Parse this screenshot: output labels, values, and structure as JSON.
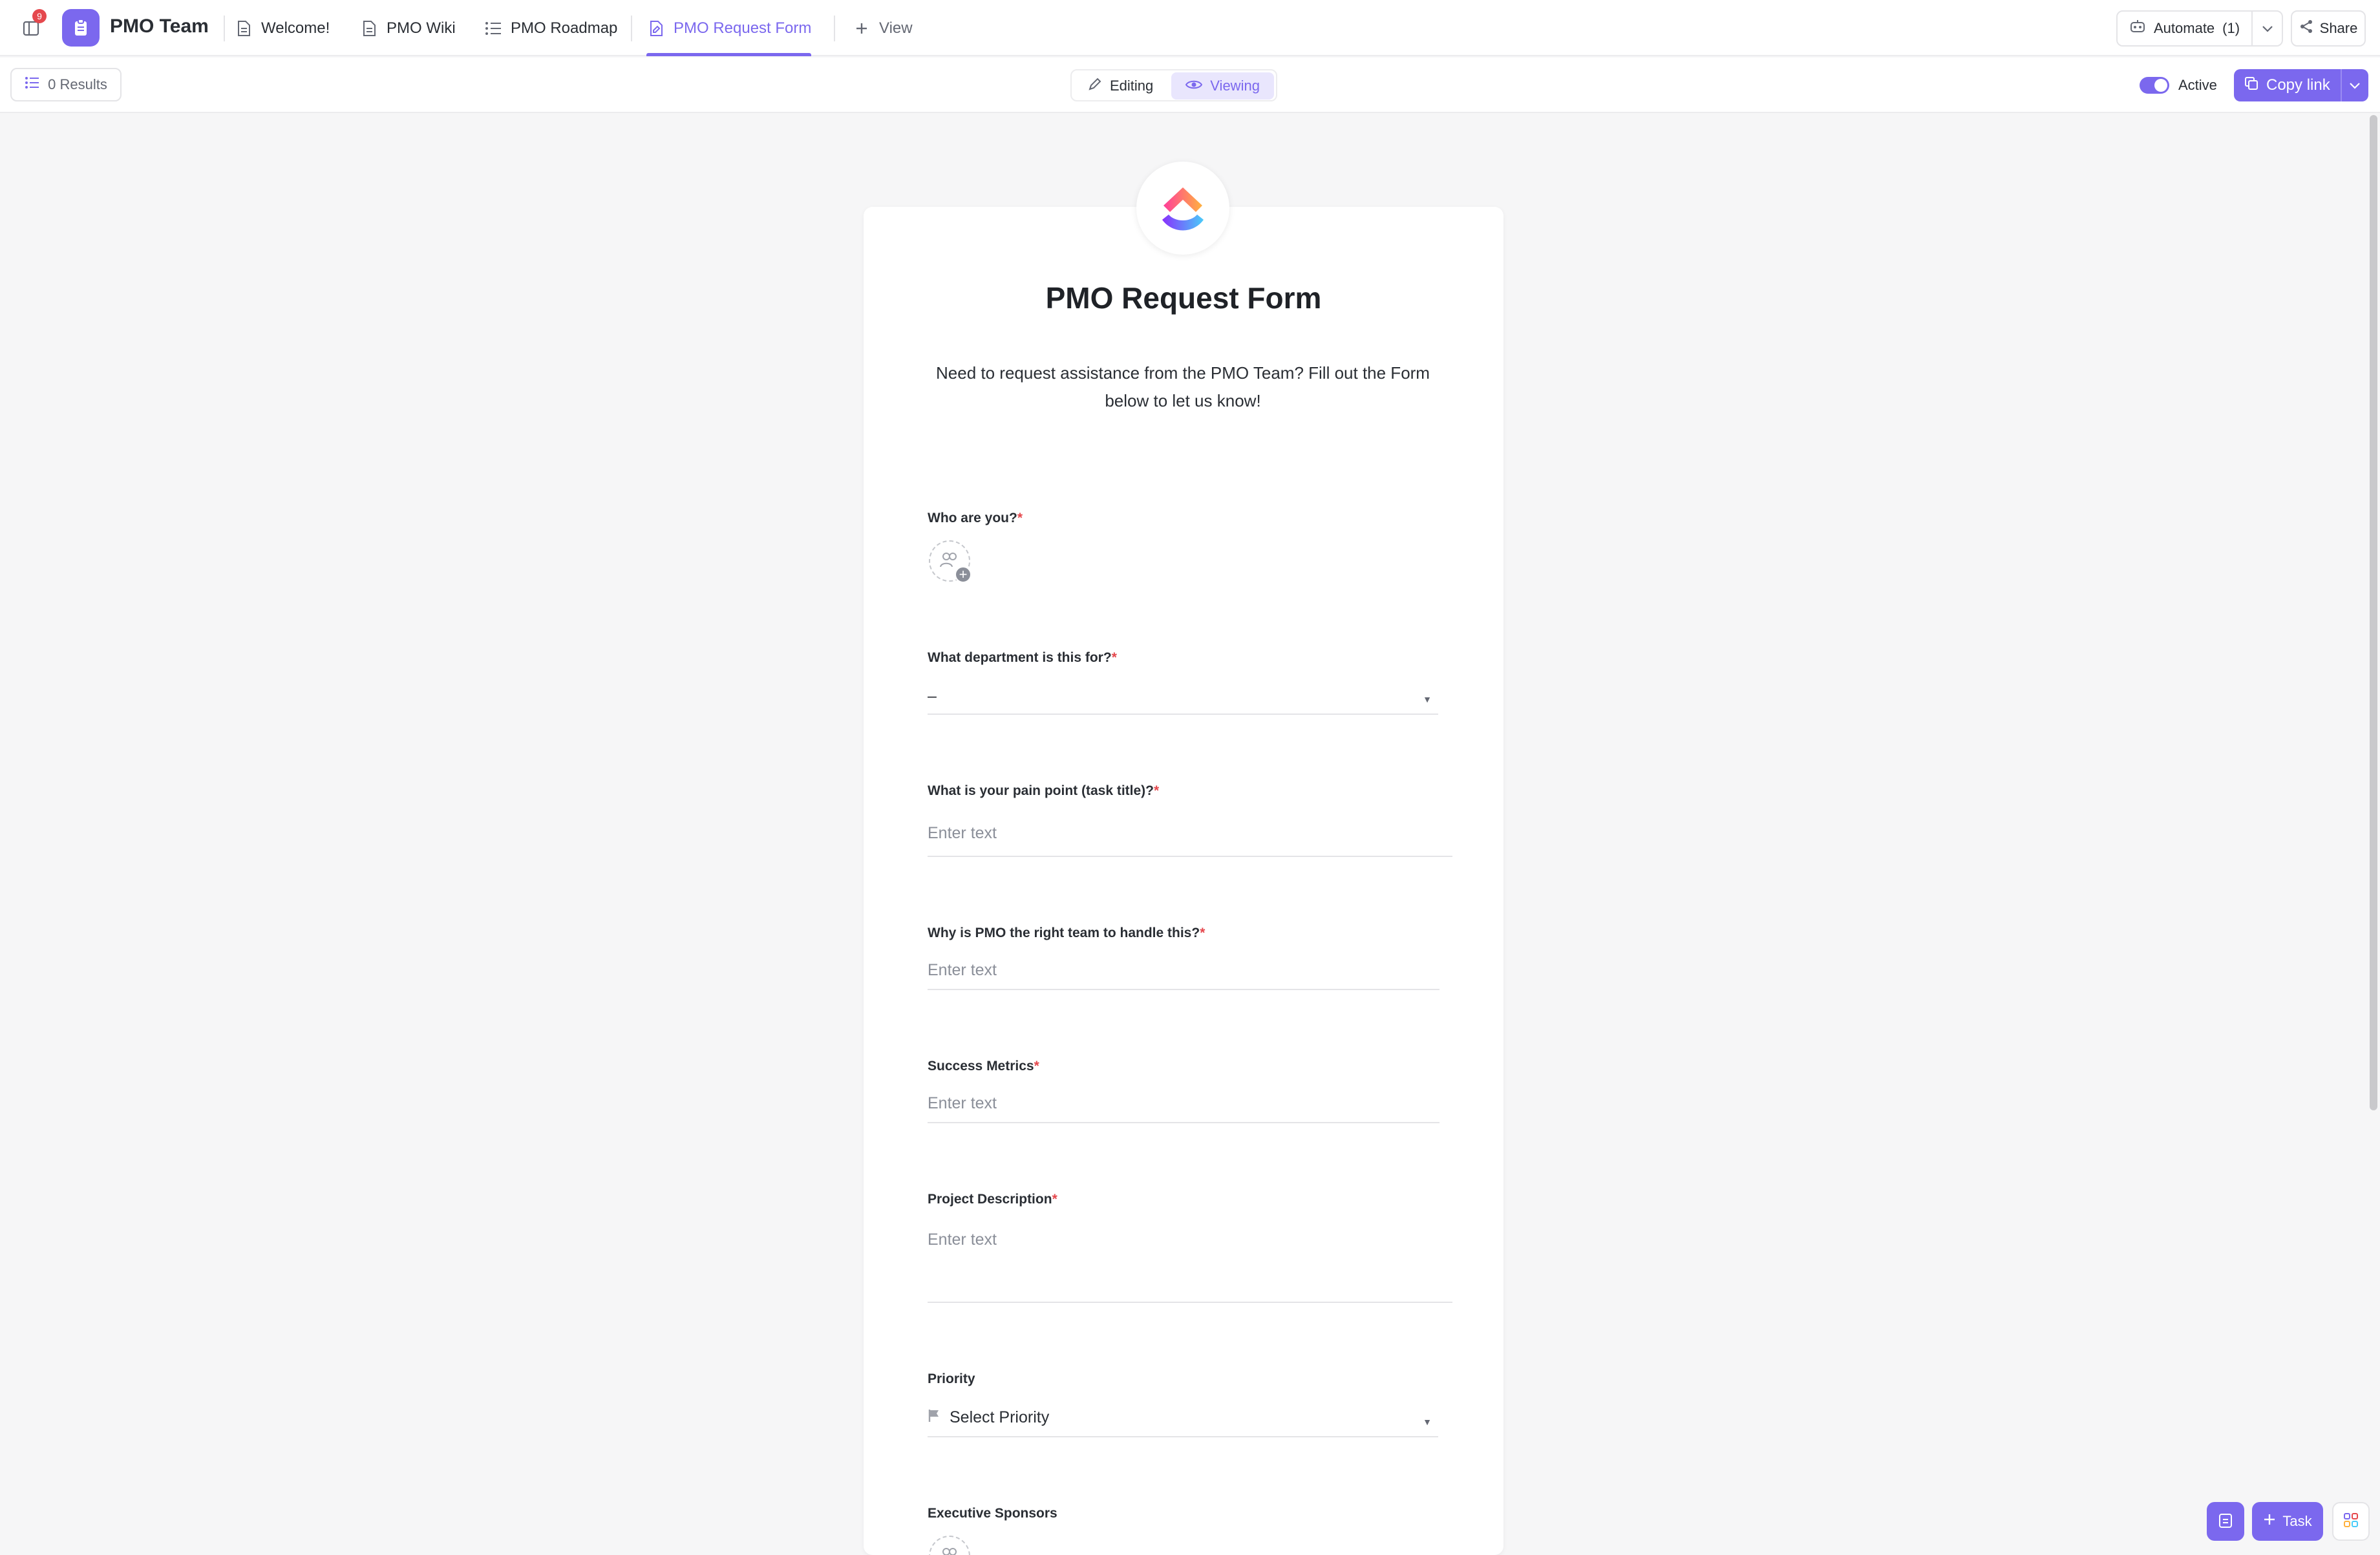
{
  "topbar": {
    "notification_count": "9",
    "space_name": "PMO Team",
    "tabs": [
      {
        "label": "Welcome!",
        "icon": "doc-icon"
      },
      {
        "label": "PMO Wiki",
        "icon": "doc-icon"
      },
      {
        "label": "PMO Roadmap",
        "icon": "list-icon"
      },
      {
        "label": "PMO Request Form",
        "icon": "form-icon",
        "active": true
      }
    ],
    "add_view_label": "View",
    "automate_label": "Automate",
    "automate_count": "(1)",
    "share_label": "Share"
  },
  "subbar": {
    "results_label": "0 Results",
    "mode_editing": "Editing",
    "mode_viewing": "Viewing",
    "active_label": "Active",
    "copy_link_label": "Copy link"
  },
  "form": {
    "title": "PMO Request Form",
    "description": "Need to request assistance from the PMO Team? Fill out the Form below to let us know!",
    "questions": [
      {
        "label": "Who are you?",
        "required": "*",
        "type": "people"
      },
      {
        "label": "What department is this for?",
        "required": "*",
        "type": "dropdown",
        "value": "–"
      },
      {
        "label": "What is your pain point (task title)?",
        "required": "*",
        "type": "text",
        "placeholder": "Enter text"
      },
      {
        "label": "Why is PMO the right team to handle this?",
        "required": "*",
        "type": "text",
        "placeholder": "Enter text"
      },
      {
        "label": "Success Metrics",
        "required": "*",
        "type": "text",
        "placeholder": "Enter text"
      },
      {
        "label": "Project Description",
        "required": "*",
        "type": "textarea",
        "placeholder": "Enter text"
      },
      {
        "label": "Priority",
        "required": "",
        "type": "dropdown",
        "value": "Select Priority"
      },
      {
        "label": "Executive Sponsors",
        "required": "",
        "type": "people"
      }
    ]
  },
  "bottom": {
    "task_label": "Task"
  },
  "colors": {
    "accent": "#7b68ee",
    "required": "#e5484d"
  }
}
